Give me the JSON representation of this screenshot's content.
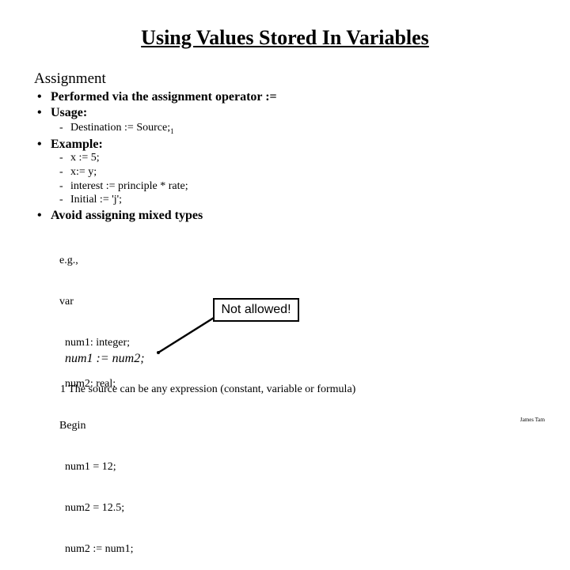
{
  "slide": {
    "title": "Using Values Stored In Variables",
    "heading": "Assignment",
    "bullets": [
      {
        "text": "Performed via the assignment operator :="
      },
      {
        "text": "Usage:",
        "subitems": [
          {
            "text": "Destination := Source;",
            "footnote_mark": "1"
          }
        ]
      },
      {
        "text": "Example:",
        "subitems": [
          {
            "text": "x := 5;"
          },
          {
            "text": "x:= y;"
          },
          {
            "text": "interest := principle * rate;"
          },
          {
            "text": "Initial := 'j';"
          }
        ]
      },
      {
        "text": "Avoid assigning mixed types"
      }
    ],
    "code_example": [
      "e.g.,",
      "var",
      "  num1: integer;",
      "  num2: real;",
      "Begin",
      "  num1 = 12;",
      "  num2 = 12.5;",
      "  num2 := num1;"
    ],
    "bad_statement": "num1 := num2;",
    "callout": "Not allowed!",
    "footnote": "1 The source can be any expression (constant, variable or formula)",
    "author": "James Tam",
    "bullet_glyph": "•",
    "dash_glyph": "-"
  }
}
